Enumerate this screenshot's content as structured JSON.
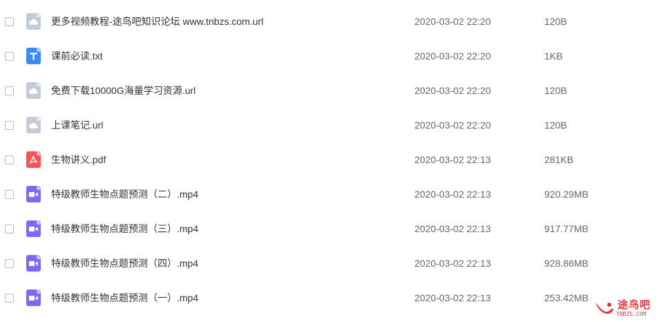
{
  "files": [
    {
      "type": "url",
      "icon": "cloud-link-icon",
      "name": "更多视频教程-途鸟吧知识论坛 www.tnbzs.com.url",
      "time": "2020-03-02 22:20",
      "size": "120B"
    },
    {
      "type": "txt",
      "icon": "text-file-icon",
      "name": "课前必读.txt",
      "time": "2020-03-02 22:20",
      "size": "1KB"
    },
    {
      "type": "url",
      "icon": "cloud-link-icon",
      "name": "免费下载10000G海量学习资源.url",
      "time": "2020-03-02 22:20",
      "size": "120B"
    },
    {
      "type": "url",
      "icon": "cloud-link-icon",
      "name": "上课笔记.url",
      "time": "2020-03-02 22:20",
      "size": "120B"
    },
    {
      "type": "pdf",
      "icon": "pdf-file-icon",
      "name": "生物讲义.pdf",
      "time": "2020-03-02 22:13",
      "size": "281KB"
    },
    {
      "type": "mp4",
      "icon": "video-file-icon",
      "name": "特级教师生物点题预测（二）.mp4",
      "time": "2020-03-02 22:13",
      "size": "920.29MB"
    },
    {
      "type": "mp4",
      "icon": "video-file-icon",
      "name": "特级教师生物点题预测（三）.mp4",
      "time": "2020-03-02 22:13",
      "size": "917.77MB"
    },
    {
      "type": "mp4",
      "icon": "video-file-icon",
      "name": "特级教师生物点题预测（四）.mp4",
      "time": "2020-03-02 22:13",
      "size": "928.86MB"
    },
    {
      "type": "mp4",
      "icon": "video-file-icon",
      "name": "特级教师生物点题预测（一）.mp4",
      "time": "2020-03-02 22:13",
      "size": "253.42MB"
    }
  ],
  "watermark": {
    "text": "途鸟吧",
    "subtext": "TNBZS.COM",
    "color": "#e4393c"
  },
  "colors": {
    "url": "#c3ccd6",
    "txt": "#3a8cf0",
    "pdf": "#f25656",
    "mp4": "#7c6bf2"
  }
}
